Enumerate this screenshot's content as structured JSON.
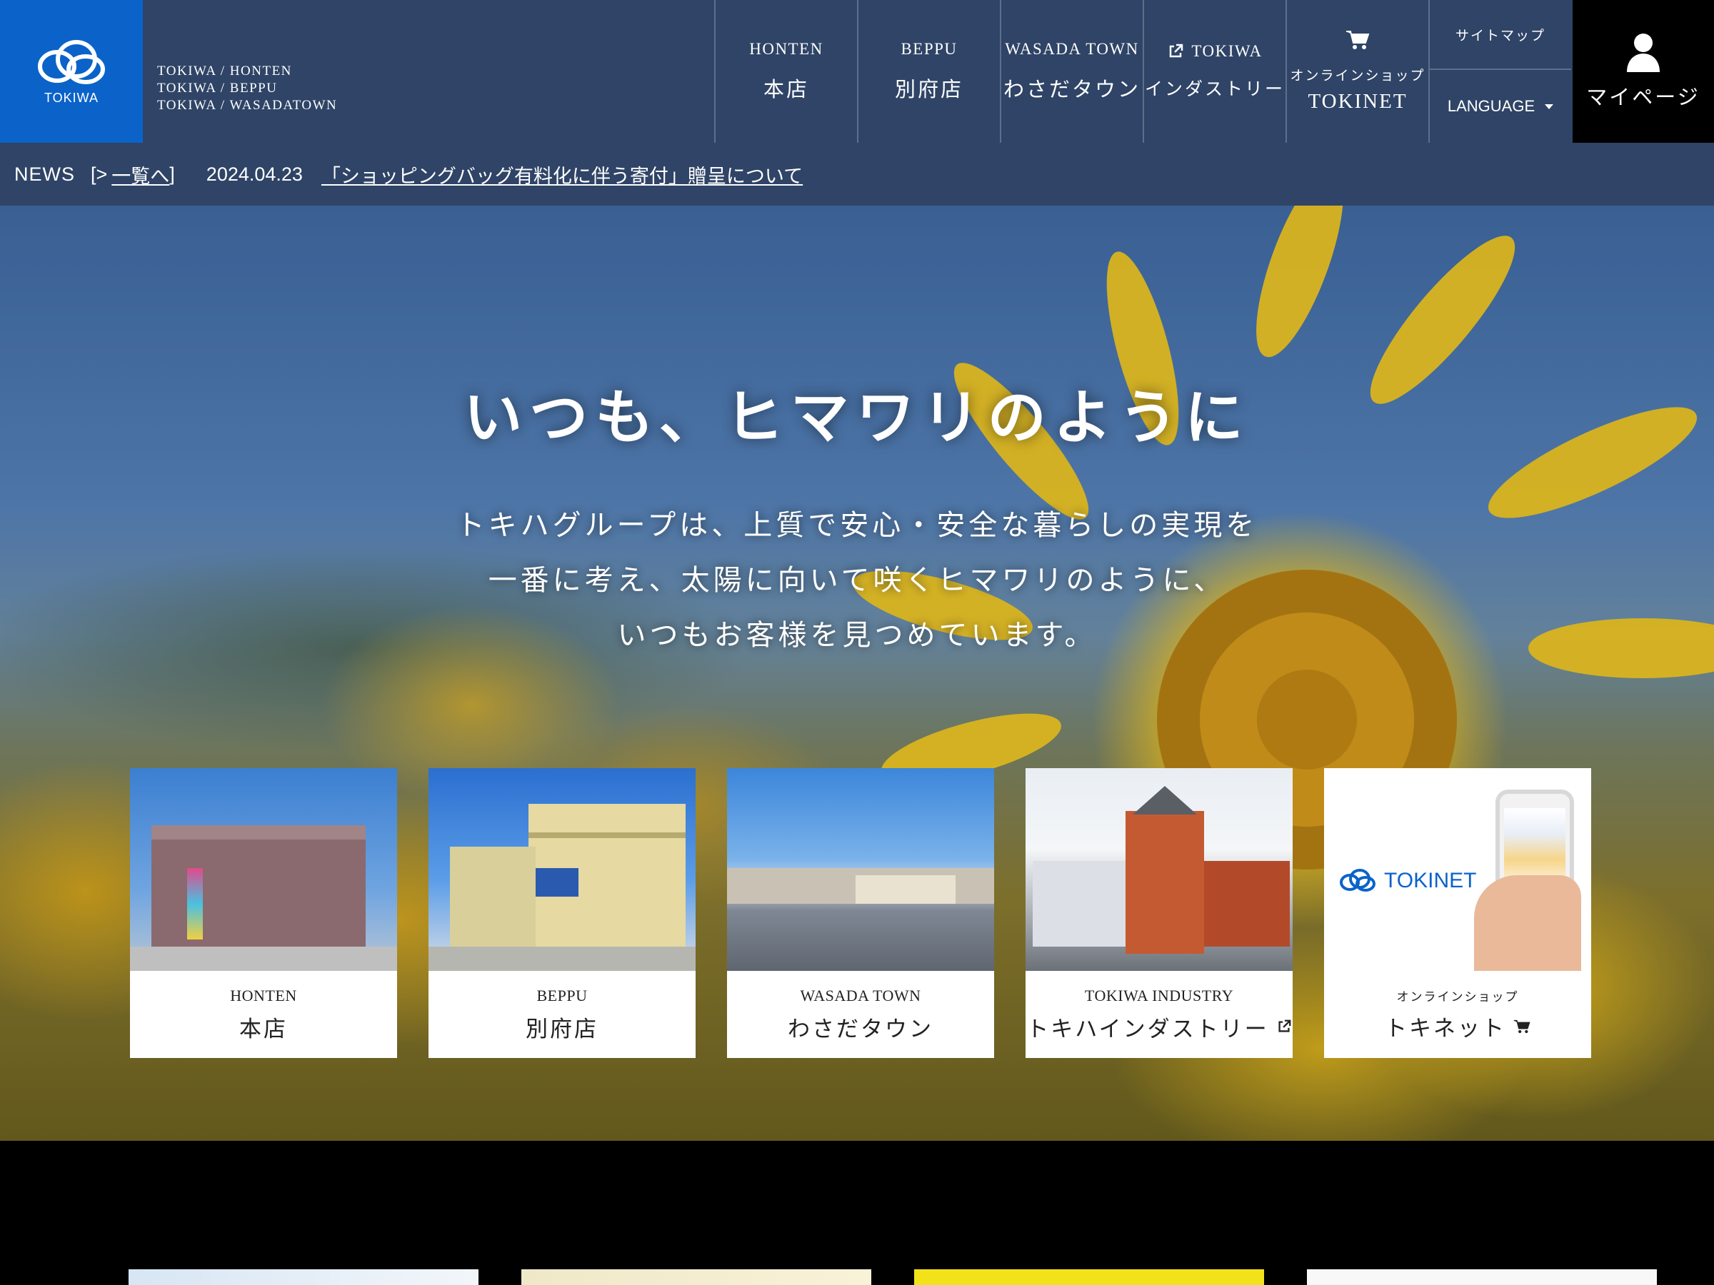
{
  "header": {
    "logo_text": "TOKIWA",
    "store_lines": [
      "TOKIWA / HONTEN",
      "TOKIWA / BEPPU",
      "TOKIWA / WASADATOWN"
    ],
    "nav": [
      {
        "en": "HONTEN",
        "ja": "本店"
      },
      {
        "en": "BEPPU",
        "ja": "別府店"
      },
      {
        "en": "WASADA TOWN",
        "ja": "わさだタウン"
      },
      {
        "en": "TOKIWA",
        "ja": "インダストリー",
        "icon": "external-link-icon"
      },
      {
        "ja_small": "オンラインショップ",
        "en": "TOKINET",
        "icon": "cart-icon"
      }
    ],
    "sitemap": "サイトマップ",
    "language": "LANGUAGE",
    "mypage": "マイページ"
  },
  "news": {
    "label": "NEWS",
    "bracket_open": "[>",
    "list_link": "一覧へ",
    "bracket_close": "]",
    "date": "2024.04.23",
    "headline": "「ショッピングバッグ有料化に伴う寄付」贈呈について"
  },
  "hero": {
    "title": "いつも、ヒマワリのように",
    "body_lines": [
      "トキハグループは、上質で安心・安全な暮らしの実現を",
      "一番に考え、太陽に向いて咲くヒマワリのように、",
      "いつもお客様を見つめています。"
    ]
  },
  "cards": [
    {
      "en": "HONTEN",
      "ja": "本店"
    },
    {
      "en": "BEPPU",
      "ja": "別府店"
    },
    {
      "en": "WASADA TOWN",
      "ja": "わさだタウン"
    },
    {
      "en": "TOKIWA INDUSTRY",
      "ja": "トキハインダストリー",
      "icon": "external-link-icon"
    },
    {
      "en": "オンラインショップ",
      "ja": "トキネット",
      "icon": "cart-icon",
      "brand": "TOKINET"
    }
  ],
  "colors": {
    "header_bg": "#2f4466",
    "logo_bg": "#0b63c9",
    "mypage_bg": "#000000",
    "sunflower": "#f5c519"
  }
}
